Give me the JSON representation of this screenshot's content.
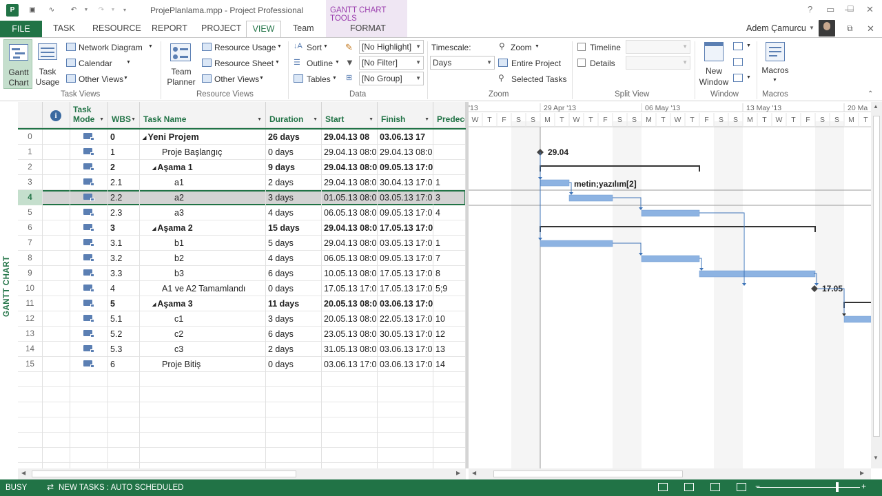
{
  "app": {
    "title": "ProjePlanlama.mpp - Project Professional",
    "context_tab_group": "GANTT CHART TOOLS",
    "user": "Adem Çamurcu",
    "help": "?"
  },
  "tabs": [
    {
      "label": "FILE"
    },
    {
      "label": "TASK"
    },
    {
      "label": "RESOURCE"
    },
    {
      "label": "REPORT"
    },
    {
      "label": "PROJECT"
    },
    {
      "label": "VIEW"
    },
    {
      "label": "Team"
    },
    {
      "label": "FORMAT"
    }
  ],
  "ribbon": {
    "task_views": {
      "gantt_chart": "Gantt Chart",
      "task_usage": "Task Usage",
      "network_diagram": "Network Diagram",
      "calendar": "Calendar",
      "other_views": "Other Views",
      "group_label": "Task Views"
    },
    "resource_views": {
      "team_planner": "Team Planner",
      "resource_usage": "Resource Usage",
      "resource_sheet": "Resource Sheet",
      "other_views": "Other Views",
      "group_label": "Resource Views"
    },
    "data": {
      "sort": "Sort",
      "outline": "Outline",
      "tables": "Tables",
      "highlight": "[No Highlight]",
      "filter": "[No Filter]",
      "group": "[No Group]",
      "group_label": "Data"
    },
    "zoom": {
      "timescale_label": "Timescale:",
      "timescale_value": "Days",
      "zoom": "Zoom",
      "entire_project": "Entire Project",
      "selected_tasks": "Selected Tasks",
      "group_label": "Zoom"
    },
    "split_view": {
      "timeline": "Timeline",
      "details": "Details",
      "timeline_checked": false,
      "details_checked": false,
      "group_label": "Split View"
    },
    "window": {
      "new_window": "New Window",
      "group_label": "Window"
    },
    "macros": {
      "macros": "Macros",
      "group_label": "Macros"
    }
  },
  "sidebar_label": "GANTT CHART",
  "table": {
    "columns": {
      "task_mode": "Task Mode",
      "wbs": "WBS",
      "task_name": "Task Name",
      "duration": "Duration",
      "start": "Start",
      "finish": "Finish",
      "predecessors": "Predecessors"
    },
    "rows": [
      {
        "id": "0",
        "wbs": "0",
        "name": "Yeni Projem",
        "duration": "26 days",
        "start": "29.04.13 08",
        "finish": "03.06.13 17",
        "pred": "",
        "level": 0,
        "summary": true,
        "selected": false
      },
      {
        "id": "1",
        "wbs": "1",
        "name": "Proje Başlangıç",
        "duration": "0 days",
        "start": "29.04.13 08:0",
        "finish": "29.04.13 08:0",
        "pred": "",
        "level": 1,
        "summary": false,
        "selected": false
      },
      {
        "id": "2",
        "wbs": "2",
        "name": "Aşama 1",
        "duration": "9 days",
        "start": "29.04.13 08:0",
        "finish": "09.05.13 17:0",
        "pred": "",
        "level": 1,
        "summary": true,
        "selected": false
      },
      {
        "id": "3",
        "wbs": "2.1",
        "name": "a1",
        "duration": "2 days",
        "start": "29.04.13 08:0",
        "finish": "30.04.13 17:0",
        "pred": "1",
        "level": 2,
        "summary": false,
        "selected": false
      },
      {
        "id": "4",
        "wbs": "2.2",
        "name": "a2",
        "duration": "3 days",
        "start": "01.05.13 08:0",
        "finish": "03.05.13 17:0",
        "pred": "3",
        "level": 2,
        "summary": false,
        "selected": true
      },
      {
        "id": "5",
        "wbs": "2.3",
        "name": "a3",
        "duration": "4 days",
        "start": "06.05.13 08:0",
        "finish": "09.05.13 17:0",
        "pred": "4",
        "level": 2,
        "summary": false,
        "selected": false
      },
      {
        "id": "6",
        "wbs": "3",
        "name": "Aşama 2",
        "duration": "15 days",
        "start": "29.04.13 08:0",
        "finish": "17.05.13 17:0",
        "pred": "",
        "level": 1,
        "summary": true,
        "selected": false
      },
      {
        "id": "7",
        "wbs": "3.1",
        "name": "b1",
        "duration": "5 days",
        "start": "29.04.13 08:0",
        "finish": "03.05.13 17:0",
        "pred": "1",
        "level": 2,
        "summary": false,
        "selected": false
      },
      {
        "id": "8",
        "wbs": "3.2",
        "name": "b2",
        "duration": "4 days",
        "start": "06.05.13 08:0",
        "finish": "09.05.13 17:0",
        "pred": "7",
        "level": 2,
        "summary": false,
        "selected": false
      },
      {
        "id": "9",
        "wbs": "3.3",
        "name": "b3",
        "duration": "6 days",
        "start": "10.05.13 08:0",
        "finish": "17.05.13 17:0",
        "pred": "8",
        "level": 2,
        "summary": false,
        "selected": false
      },
      {
        "id": "10",
        "wbs": "4",
        "name": "A1 ve A2 Tamamlandı",
        "duration": "0 days",
        "start": "17.05.13 17:0",
        "finish": "17.05.13 17:0",
        "pred": "5;9",
        "level": 1,
        "summary": false,
        "selected": false
      },
      {
        "id": "11",
        "wbs": "5",
        "name": "Aşama 3",
        "duration": "11 days",
        "start": "20.05.13 08:0",
        "finish": "03.06.13 17:0",
        "pred": "",
        "level": 1,
        "summary": true,
        "selected": false
      },
      {
        "id": "12",
        "wbs": "5.1",
        "name": "c1",
        "duration": "3 days",
        "start": "20.05.13 08:0",
        "finish": "22.05.13 17:0",
        "pred": "10",
        "level": 2,
        "summary": false,
        "selected": false
      },
      {
        "id": "13",
        "wbs": "5.2",
        "name": "c2",
        "duration": "6 days",
        "start": "23.05.13 08:0",
        "finish": "30.05.13 17:0",
        "pred": "12",
        "level": 2,
        "summary": false,
        "selected": false
      },
      {
        "id": "14",
        "wbs": "5.3",
        "name": "c3",
        "duration": "2 days",
        "start": "31.05.13 08:0",
        "finish": "03.06.13 17:0",
        "pred": "13",
        "level": 2,
        "summary": false,
        "selected": false
      },
      {
        "id": "15",
        "wbs": "6",
        "name": "Proje Bitiş",
        "duration": "0 days",
        "start": "03.06.13 17:0",
        "finish": "03.06.13 17:0",
        "pred": "14",
        "level": 1,
        "summary": false,
        "selected": false
      }
    ]
  },
  "gantt": {
    "weeks": [
      {
        "label": "29 Apr '13"
      },
      {
        "label": "06 May '13"
      },
      {
        "label": "13 May '13"
      },
      {
        "label": "20 Ma"
      }
    ],
    "weeks_partial_left": "'13",
    "day_letters": [
      "W",
      "T",
      "F",
      "S",
      "S",
      "M",
      "T",
      "W",
      "T",
      "F",
      "S",
      "S",
      "M",
      "T",
      "W",
      "T",
      "F",
      "S",
      "S",
      "M",
      "T",
      "W",
      "T",
      "F",
      "S",
      "S",
      "M",
      "T"
    ],
    "milestone_labels": {
      "start": "29.04",
      "a1a2": "17.05"
    },
    "bar_label": "metin;yazılım[2]"
  },
  "status": {
    "mode": "BUSY",
    "new_tasks": "NEW TASKS : AUTO SCHEDULED"
  }
}
